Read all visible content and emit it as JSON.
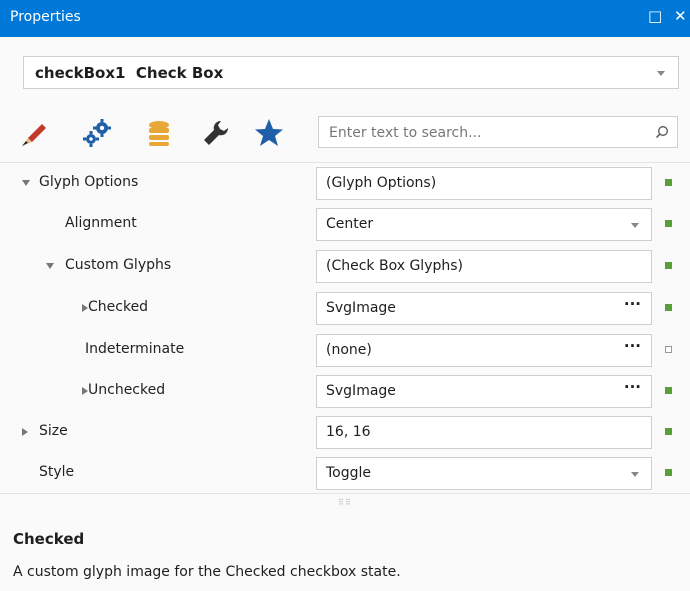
{
  "window": {
    "title": "Properties",
    "restore_glyph": "□",
    "close_glyph": "✕"
  },
  "object_selector": {
    "name": "checkBox1",
    "type": "Check Box"
  },
  "toolbar": {
    "icons": [
      "brush-icon",
      "gears-icon",
      "database-icon",
      "wrench-icon",
      "star-icon"
    ],
    "search_placeholder": "Enter text to search..."
  },
  "properties": [
    {
      "name": "Glyph Options",
      "value": "(Glyph Options)",
      "indent": 0,
      "expander": "open",
      "editor": "text",
      "modified": true
    },
    {
      "name": "Alignment",
      "value": "Center",
      "indent": 1,
      "expander": "none",
      "editor": "dropdown",
      "modified": true
    },
    {
      "name": "Custom Glyphs",
      "value": "(Check Box Glyphs)",
      "indent": 1,
      "expander": "open",
      "editor": "text",
      "modified": true
    },
    {
      "name": "Checked",
      "value": "SvgImage",
      "indent": 2,
      "expander": "closed",
      "editor": "ellipsis",
      "modified": true
    },
    {
      "name": "Indeterminate",
      "value": "(none)",
      "indent": 2,
      "expander": "none",
      "editor": "ellipsis",
      "modified": false
    },
    {
      "name": "Unchecked",
      "value": "SvgImage",
      "indent": 2,
      "expander": "closed",
      "editor": "ellipsis",
      "modified": true
    },
    {
      "name": "Size",
      "value": "16, 16",
      "indent": 0,
      "expander": "closed",
      "editor": "text",
      "modified": true
    },
    {
      "name": "Style",
      "value": "Toggle",
      "indent": 0,
      "expander": "none",
      "editor": "dropdown",
      "modified": true
    }
  ],
  "ellipsis_glyph": "···",
  "splitter_glyph": "⠿⠿",
  "description": {
    "title": "Checked",
    "text": "A custom glyph image for the Checked checkbox state."
  },
  "colors": {
    "titlebar": "#0078d7",
    "modified_marker": "#5a9e3c"
  }
}
